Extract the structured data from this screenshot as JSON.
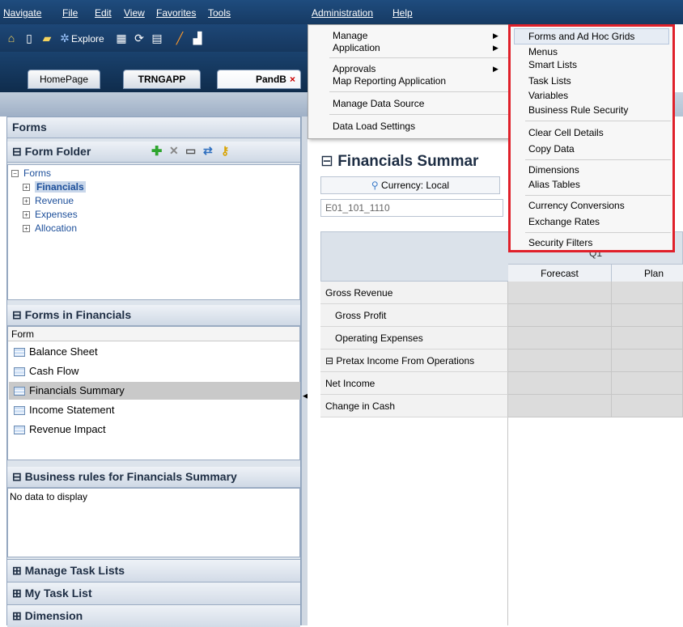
{
  "menubar": {
    "items": [
      {
        "label": "Navigate"
      },
      {
        "label": "File"
      },
      {
        "label": "Edit"
      },
      {
        "label": "View"
      },
      {
        "label": "Favorites"
      },
      {
        "label": "Tools"
      },
      {
        "label": "Administration"
      },
      {
        "label": "Help"
      }
    ]
  },
  "toolbar": {
    "explore_label": "Explore"
  },
  "tabs": [
    {
      "label": "HomePage"
    },
    {
      "label": "TRNGAPP"
    },
    {
      "label": "PandB",
      "close": "×"
    }
  ],
  "left": {
    "forms_header": "Forms",
    "form_folder_header": "Form Folder",
    "tree": [
      {
        "label": "Forms"
      },
      {
        "label": "Financials"
      },
      {
        "label": "Revenue"
      },
      {
        "label": "Expenses"
      },
      {
        "label": "Allocation"
      }
    ],
    "forms_in_header": "Forms in Financials",
    "form_col_header": "Form",
    "forms": [
      {
        "label": "Balance Sheet"
      },
      {
        "label": "Cash Flow"
      },
      {
        "label": "Financials Summary"
      },
      {
        "label": "Income Statement"
      },
      {
        "label": "Revenue Impact"
      }
    ],
    "rules_header": "Business rules for Financials Summary",
    "rules_empty": "No data to display",
    "collapsed": [
      {
        "label": "Manage Task Lists"
      },
      {
        "label": "My Task List"
      },
      {
        "label": "Dimension"
      }
    ]
  },
  "main": {
    "form_title": "Financials Summar",
    "currency": "Currency: Local",
    "pov_value": "E01_101_1110",
    "period": "Q1",
    "columns": [
      "Forecast",
      "Plan"
    ],
    "rows": [
      {
        "label": "Gross Revenue"
      },
      {
        "label": "Gross Profit"
      },
      {
        "label": "Operating Expenses"
      },
      {
        "label": "Pretax Income From Operations"
      },
      {
        "label": "Net Income"
      },
      {
        "label": "Change in Cash"
      }
    ]
  },
  "admin_menu": {
    "items": [
      {
        "label": "Manage"
      },
      {
        "label": "Application"
      },
      {
        "label": "Approvals"
      },
      {
        "label": "Map Reporting Application"
      },
      {
        "label": "Manage Data Source"
      },
      {
        "label": "Data Load Settings"
      }
    ]
  },
  "manage_submenu": {
    "items": [
      {
        "label": "Forms and Ad Hoc Grids"
      },
      {
        "label": "Menus"
      },
      {
        "label": "Smart Lists"
      },
      {
        "label": "Task Lists"
      },
      {
        "label": "Variables"
      },
      {
        "label": "Business Rule Security"
      },
      {
        "label": "Clear Cell Details"
      },
      {
        "label": "Copy Data"
      },
      {
        "label": "Dimensions"
      },
      {
        "label": "Alias Tables"
      },
      {
        "label": "Currency Conversions"
      },
      {
        "label": "Exchange Rates"
      },
      {
        "label": "Security Filters"
      }
    ],
    "highlight_color": "#e0202a"
  }
}
